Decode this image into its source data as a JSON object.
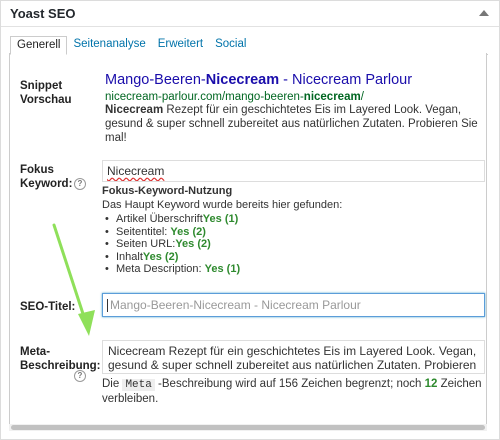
{
  "box": {
    "title": "Yoast SEO"
  },
  "tabs": [
    {
      "label": "Generell"
    },
    {
      "label": "Seitenanalyse"
    },
    {
      "label": "Erweitert"
    },
    {
      "label": "Social"
    }
  ],
  "snippet": {
    "label": "Snippet Vorschau",
    "title_pre": "Mango-Beeren-",
    "title_kw": "Nicecream",
    "title_post": " - Nicecream Parlour",
    "url_pre": "nicecream-parlour.com/mango-beeren-",
    "url_kw": "nicecream",
    "url_post": "/",
    "desc_kw": "Nicecream",
    "desc_rest": " Rezept für ein geschichtetes Eis im Layered Look. Vegan, gesund & super schnell zubereitet aus natürlichen Zutaten. Probieren Sie mal!"
  },
  "focus": {
    "label": "Fokus Keyword:",
    "value": "Nicecream",
    "usage_heading": "Fokus-Keyword-Nutzung",
    "usage_intro": "Das Haupt Keyword wurde bereits hier gefunden:",
    "items": [
      {
        "label": "Artikel Überschrift",
        "result": "Yes (1)"
      },
      {
        "label": "Seitentitel: ",
        "result": "Yes (2)"
      },
      {
        "label": "Seiten URL:",
        "result": "Yes (2)"
      },
      {
        "label": "Inhalt",
        "result": "Yes (2)"
      },
      {
        "label": "Meta Description: ",
        "result": "Yes (1)"
      }
    ]
  },
  "seo_title": {
    "label": "SEO-Titel:",
    "placeholder": "Mango-Beeren-Nicecream  - Nicecream Parlour"
  },
  "meta": {
    "label": "Meta-Beschreibung:",
    "value": "Nicecream Rezept für ein geschichtetes Eis im Layered Look. Vegan, gesund & super schnell zubereitet aus natürlichen Zutaten. Probieren Sie mal!",
    "counter_pre": "Die ",
    "counter_code": "Meta",
    "counter_mid": " -Beschreibung wird auf 156 Zeichen begrenzt; noch ",
    "counter_num": "12",
    "counter_post": " Zeichen verbleiben."
  },
  "help_icon": "?",
  "colors": {
    "link": "#0073aa",
    "snippet_title": "#1a0dab",
    "snippet_url": "#006621",
    "success": "#2e8a2e",
    "annotation_arrow": "#8fe05a"
  }
}
